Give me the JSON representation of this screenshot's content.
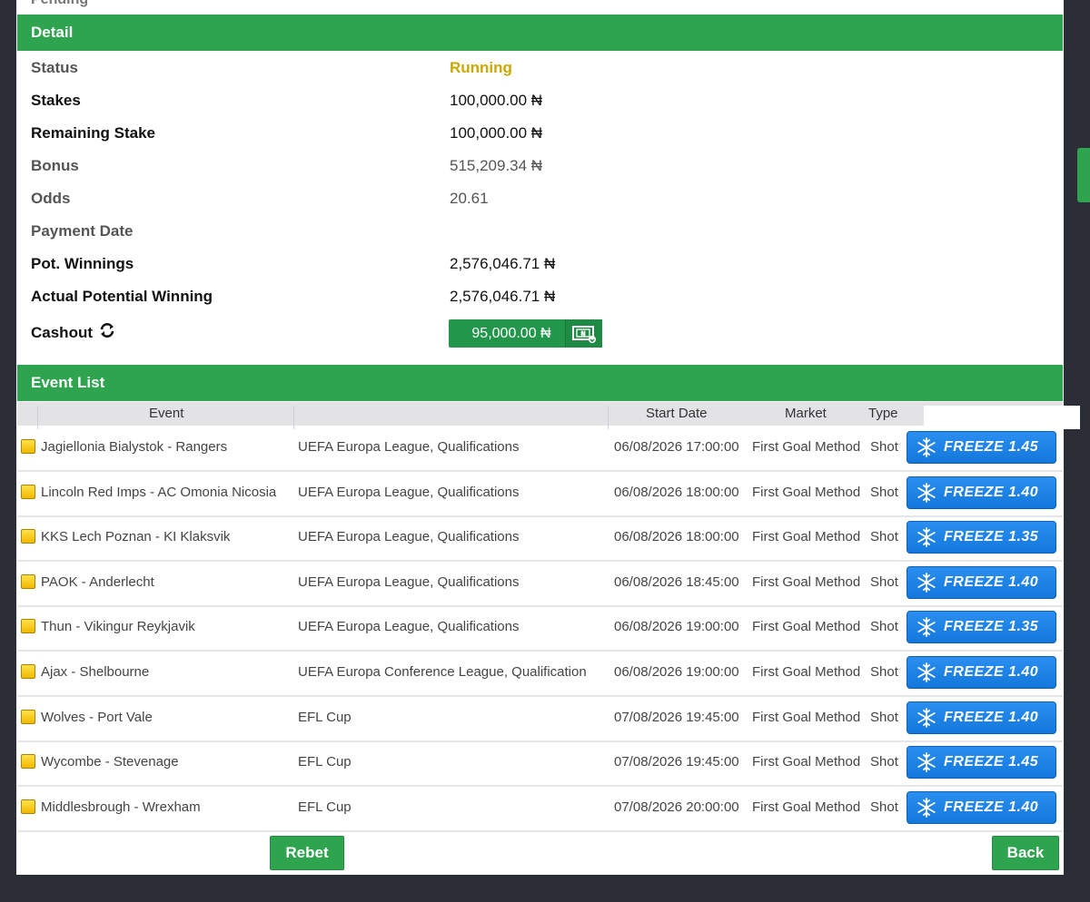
{
  "pending_label": "Pending",
  "detail": {
    "header": "Detail",
    "rows": [
      {
        "label": "Status",
        "value": "Running"
      },
      {
        "label": "Stakes",
        "value": "100,000.00 ₦"
      },
      {
        "label": "Remaining Stake",
        "value": "100,000.00 ₦"
      },
      {
        "label": "Bonus",
        "value": "515,209.34 ₦"
      },
      {
        "label": "Odds",
        "value": "20.61"
      },
      {
        "label": "Payment Date",
        "value": ""
      },
      {
        "label": "Pot. Winnings",
        "value": "2,576,046.71 ₦"
      },
      {
        "label": "Actual Potential Winning",
        "value": "2,576,046.71 ₦"
      }
    ],
    "cashout": {
      "label": "Cashout",
      "amount": "95,000.00 ₦",
      "icon": "cash-icon"
    }
  },
  "events": {
    "header": "Event List",
    "columns": [
      "Event",
      "Start Date",
      "Market",
      "Type"
    ],
    "rows": [
      {
        "event": "Jagiellonia Bialystok - Rangers",
        "competition": "UEFA Europa League, Qualifications",
        "start": "06/08/2026 17:00:00",
        "market": "First Goal Method",
        "type": "Shot",
        "freeze": "FREEZE 1.45"
      },
      {
        "event": "Lincoln Red Imps - AC Omonia Nicosia",
        "competition": "UEFA Europa League, Qualifications",
        "start": "06/08/2026 18:00:00",
        "market": "First Goal Method",
        "type": "Shot",
        "freeze": "FREEZE 1.40"
      },
      {
        "event": "KKS Lech Poznan - KI Klaksvik",
        "competition": "UEFA Europa League, Qualifications",
        "start": "06/08/2026 18:00:00",
        "market": "First Goal Method",
        "type": "Shot",
        "freeze": "FREEZE 1.35"
      },
      {
        "event": "PAOK - Anderlecht",
        "competition": "UEFA Europa League, Qualifications",
        "start": "06/08/2026 18:45:00",
        "market": "First Goal Method",
        "type": "Shot",
        "freeze": "FREEZE 1.40"
      },
      {
        "event": "Thun - Vikingur Reykjavik",
        "competition": "UEFA Europa League, Qualifications",
        "start": "06/08/2026 19:00:00",
        "market": "First Goal Method",
        "type": "Shot",
        "freeze": "FREEZE 1.35"
      },
      {
        "event": "Ajax - Shelbourne",
        "competition": "UEFA Europa Conference League, Qualification",
        "start": "06/08/2026 19:00:00",
        "market": "First Goal Method",
        "type": "Shot",
        "freeze": "FREEZE 1.40"
      },
      {
        "event": "Wolves - Port Vale",
        "competition": "EFL Cup",
        "start": "07/08/2026 19:45:00",
        "market": "First Goal Method",
        "type": "Shot",
        "freeze": "FREEZE 1.40"
      },
      {
        "event": "Wycombe - Stevenage",
        "competition": "EFL Cup",
        "start": "07/08/2026 19:45:00",
        "market": "First Goal Method",
        "type": "Shot",
        "freeze": "FREEZE 1.45"
      },
      {
        "event": "Middlesbrough - Wrexham",
        "competition": "EFL Cup",
        "start": "07/08/2026 20:00:00",
        "market": "First Goal Method",
        "type": "Shot",
        "freeze": "FREEZE 1.40"
      }
    ]
  },
  "buttons": {
    "rebet": "Rebet",
    "back": "Back"
  },
  "colors": {
    "brand_green": "#2ea44f",
    "freeze_blue": "#1a82e6",
    "running": "#c9a800"
  }
}
